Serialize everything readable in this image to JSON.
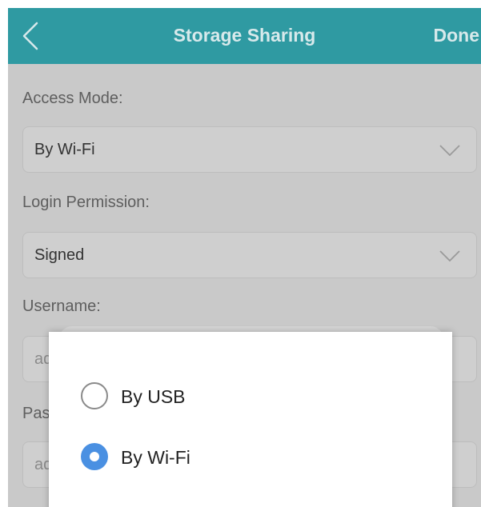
{
  "header": {
    "title": "Storage Sharing",
    "done_label": "Done"
  },
  "form": {
    "access_mode_label": "Access Mode:",
    "access_mode_value": "By Wi-Fi",
    "login_permission_label": "Login Permission:",
    "login_permission_value": "Signed",
    "username_label": "Username:",
    "username_partial": "ad",
    "password_label_partial": "Pas",
    "password_partial": "ad"
  },
  "dialog": {
    "options": [
      {
        "label": "By USB",
        "selected": false
      },
      {
        "label": "By Wi-Fi",
        "selected": true
      }
    ]
  },
  "colors": {
    "header_bg": "#2f9aa2",
    "radio_selected": "#4a90e2",
    "overlay": "#c9c9c9"
  }
}
